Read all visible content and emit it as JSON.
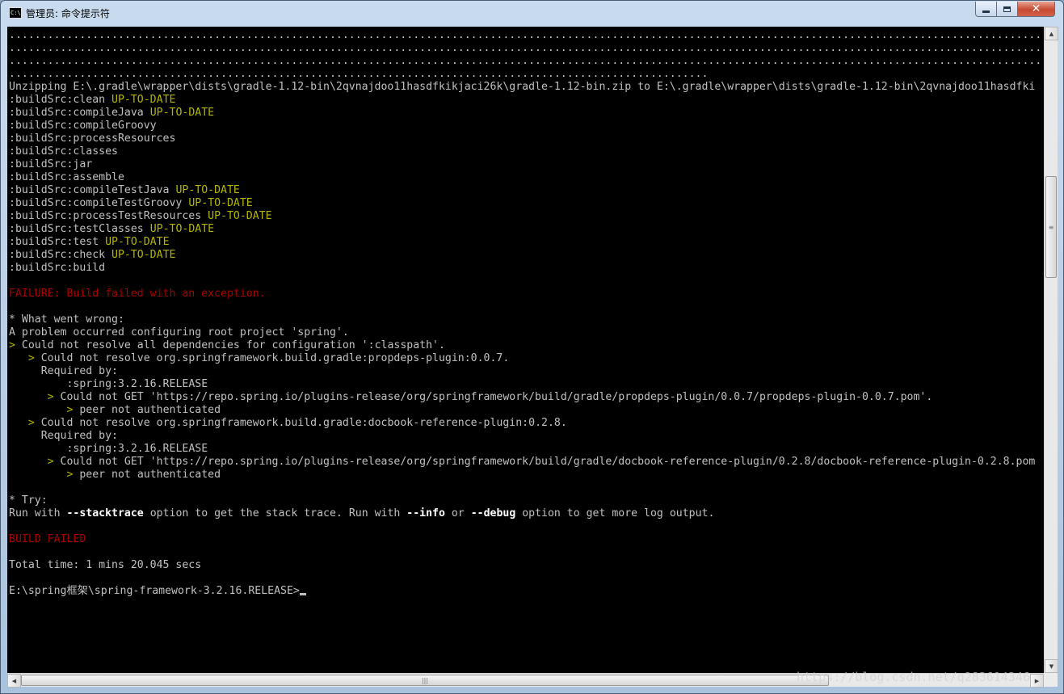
{
  "window": {
    "title": "管理员: 命令提示符",
    "icon_label": "C:\\.",
    "controls": {
      "minimize": "minimize-icon",
      "maximize": "maximize-icon",
      "close": "close-icon"
    }
  },
  "console": {
    "dots_row": "............................................................................................................................................................................",
    "dots_row_short": ".............................................................................................................",
    "unzip": "Unzipping E:\\.gradle\\wrapper\\dists\\gradle-1.12-bin\\2qvnajdoo11hasdfkikjaci26k\\gradle-1.12-bin.zip to E:\\.gradle\\wrapper\\dists\\gradle-1.12-bin\\2qvnajdoo11hasdfki",
    "up_to_date": "UP-TO-DATE",
    "tasks": [
      ":buildSrc:clean",
      ":buildSrc:compileJava",
      ":buildSrc:compileGroovy",
      ":buildSrc:processResources",
      ":buildSrc:classes",
      ":buildSrc:jar",
      ":buildSrc:assemble",
      ":buildSrc:compileTestJava",
      ":buildSrc:compileTestGroovy",
      ":buildSrc:processTestResources",
      ":buildSrc:testClasses",
      ":buildSrc:test",
      ":buildSrc:check",
      ":buildSrc:build"
    ],
    "failure": "FAILURE: Build failed with an exception.",
    "what_went_wrong": "* What went wrong:",
    "problem": "A problem occurred configuring root project 'spring'.",
    "resolve_all_arrow": "> ",
    "resolve_all": "Could not resolve all dependencies for configuration ':classpath'.",
    "dep1": {
      "resolve": "Could not resolve org.springframework.build.gradle:propdeps-plugin:0.0.7.",
      "required_by": "Required by:",
      "release": ":spring:3.2.16.RELEASE",
      "get": "Could not GET 'https://repo.spring.io/plugins-release/org/springframework/build/gradle/propdeps-plugin/0.0.7/propdeps-plugin-0.0.7.pom'.",
      "peer": "peer not authenticated"
    },
    "dep2": {
      "resolve": "Could not resolve org.springframework.build.gradle:docbook-reference-plugin:0.2.8.",
      "required_by": "Required by:",
      "release": ":spring:3.2.16.RELEASE",
      "get": "Could not GET 'https://repo.spring.io/plugins-release/org/springframework/build/gradle/docbook-reference-plugin/0.2.8/docbook-reference-plugin-0.2.8.pom",
      "peer": "peer not authenticated"
    },
    "try": "* Try:",
    "run_with_1": "Run with ",
    "stacktrace": "--stacktrace",
    "run_with_2": " option to get the stack trace. Run with ",
    "info": "--info",
    "or": " or ",
    "debug": "--debug",
    "run_with_3": " option to get more log output.",
    "build_failed": "BUILD FAILED",
    "total_time": "Total time: 1 mins 20.045 secs",
    "prompt": "E:\\spring框架\\spring-framework-3.2.16.RELEASE>"
  },
  "watermark": "https://blog.csdn.net/q283614346",
  "colors": {
    "console_bg": "#000000",
    "console_text": "#c0c0c0",
    "up_to_date": "#b5b500",
    "failure": "#a80000"
  }
}
